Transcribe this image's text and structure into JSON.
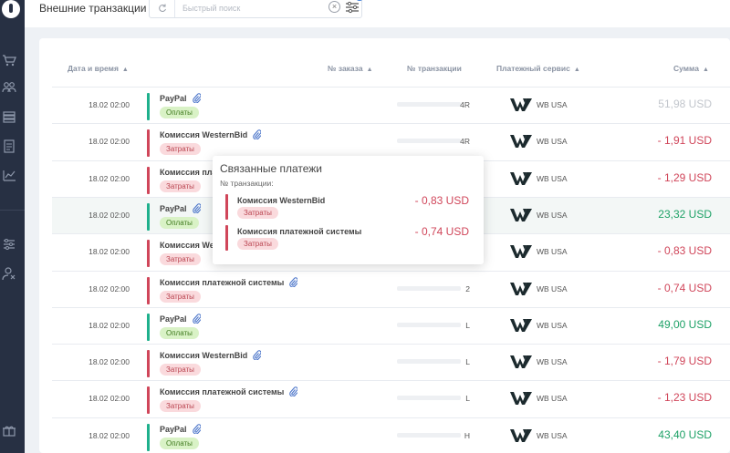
{
  "topbar": {
    "title": "Внешние транзакции",
    "search_placeholder": "Быстрый поиск",
    "clear_symbol": "×"
  },
  "table": {
    "headers": {
      "date": "Дата и время",
      "order": "№ заказа",
      "transaction": "№ транзакции",
      "service": "Платежный сервис",
      "amount": "Сумма"
    },
    "rows": [
      {
        "date": "18.02 02:00",
        "name": "PayPal",
        "tag": "Оплаты",
        "kind": "pay",
        "tx": "4R",
        "service": "WB USA",
        "amount": "51,98 USD",
        "amount_style": "grey",
        "highlight": false
      },
      {
        "date": "18.02 02:00",
        "name": "Комиссия WesternBid",
        "tag": "Затраты",
        "kind": "cost",
        "tx": "4R",
        "service": "WB USA",
        "amount": "- 1,91 USD",
        "amount_style": "red",
        "highlight": false
      },
      {
        "date": "18.02 02:00",
        "name": "Комиссия платежной системы",
        "tag": "Затраты",
        "kind": "cost",
        "tx": "",
        "service": "WB USA",
        "amount": "- 1,29 USD",
        "amount_style": "red",
        "highlight": false
      },
      {
        "date": "18.02 02:00",
        "name": "PayPal",
        "tag": "Оплаты",
        "kind": "pay",
        "tx": "",
        "service": "WB USA",
        "amount": "23,32 USD",
        "amount_style": "green",
        "highlight": true
      },
      {
        "date": "18.02 02:00",
        "name": "Комиссия WesternBid",
        "tag": "Затраты",
        "kind": "cost",
        "tx": "",
        "service": "WB USA",
        "amount": "- 0,83 USD",
        "amount_style": "red",
        "highlight": false
      },
      {
        "date": "18.02 02:00",
        "name": "Комиссия платежной системы",
        "tag": "Затраты",
        "kind": "cost",
        "tx": "2",
        "service": "WB USA",
        "amount": "- 0,74 USD",
        "amount_style": "red",
        "highlight": false
      },
      {
        "date": "18.02 02:00",
        "name": "PayPal",
        "tag": "Оплаты",
        "kind": "pay",
        "tx": "L",
        "service": "WB USA",
        "amount": "49,00 USD",
        "amount_style": "green",
        "highlight": false
      },
      {
        "date": "18.02 02:00",
        "name": "Комиссия WesternBid",
        "tag": "Затраты",
        "kind": "cost",
        "tx": "L",
        "service": "WB USA",
        "amount": "- 1,79 USD",
        "amount_style": "red",
        "highlight": false
      },
      {
        "date": "18.02 02:00",
        "name": "Комиссия платежной системы",
        "tag": "Затраты",
        "kind": "cost",
        "tx": "L",
        "service": "WB USA",
        "amount": "- 1,23 USD",
        "amount_style": "red",
        "highlight": false
      },
      {
        "date": "18.02 02:00",
        "name": "PayPal",
        "tag": "Оплаты",
        "kind": "pay",
        "tx": "H",
        "service": "WB USA",
        "amount": "43,40 USD",
        "amount_style": "green",
        "highlight": false
      }
    ]
  },
  "popup": {
    "title": "Связанные платежи",
    "subtitle": "№ транзакции:",
    "items": [
      {
        "name": "Комиссия WesternBid",
        "tag": "Затраты",
        "amount": "- 0,83 USD"
      },
      {
        "name": "Комиссия платежной системы",
        "tag": "Затраты",
        "amount": "- 0,74 USD"
      }
    ]
  },
  "colors": {
    "sidebar": "#273043",
    "green": "#1da166",
    "red": "#d0465a",
    "accent": "#3d7dd8"
  },
  "icons": [
    "refresh-icon",
    "filter-icon",
    "paperclip-icon",
    "sort-icon",
    "wb-logo-icon",
    "cart-icon",
    "users-icon",
    "stack-icon",
    "clipboard-icon",
    "chart-icon",
    "sliders-icon",
    "user-settings-icon",
    "gift-icon"
  ]
}
